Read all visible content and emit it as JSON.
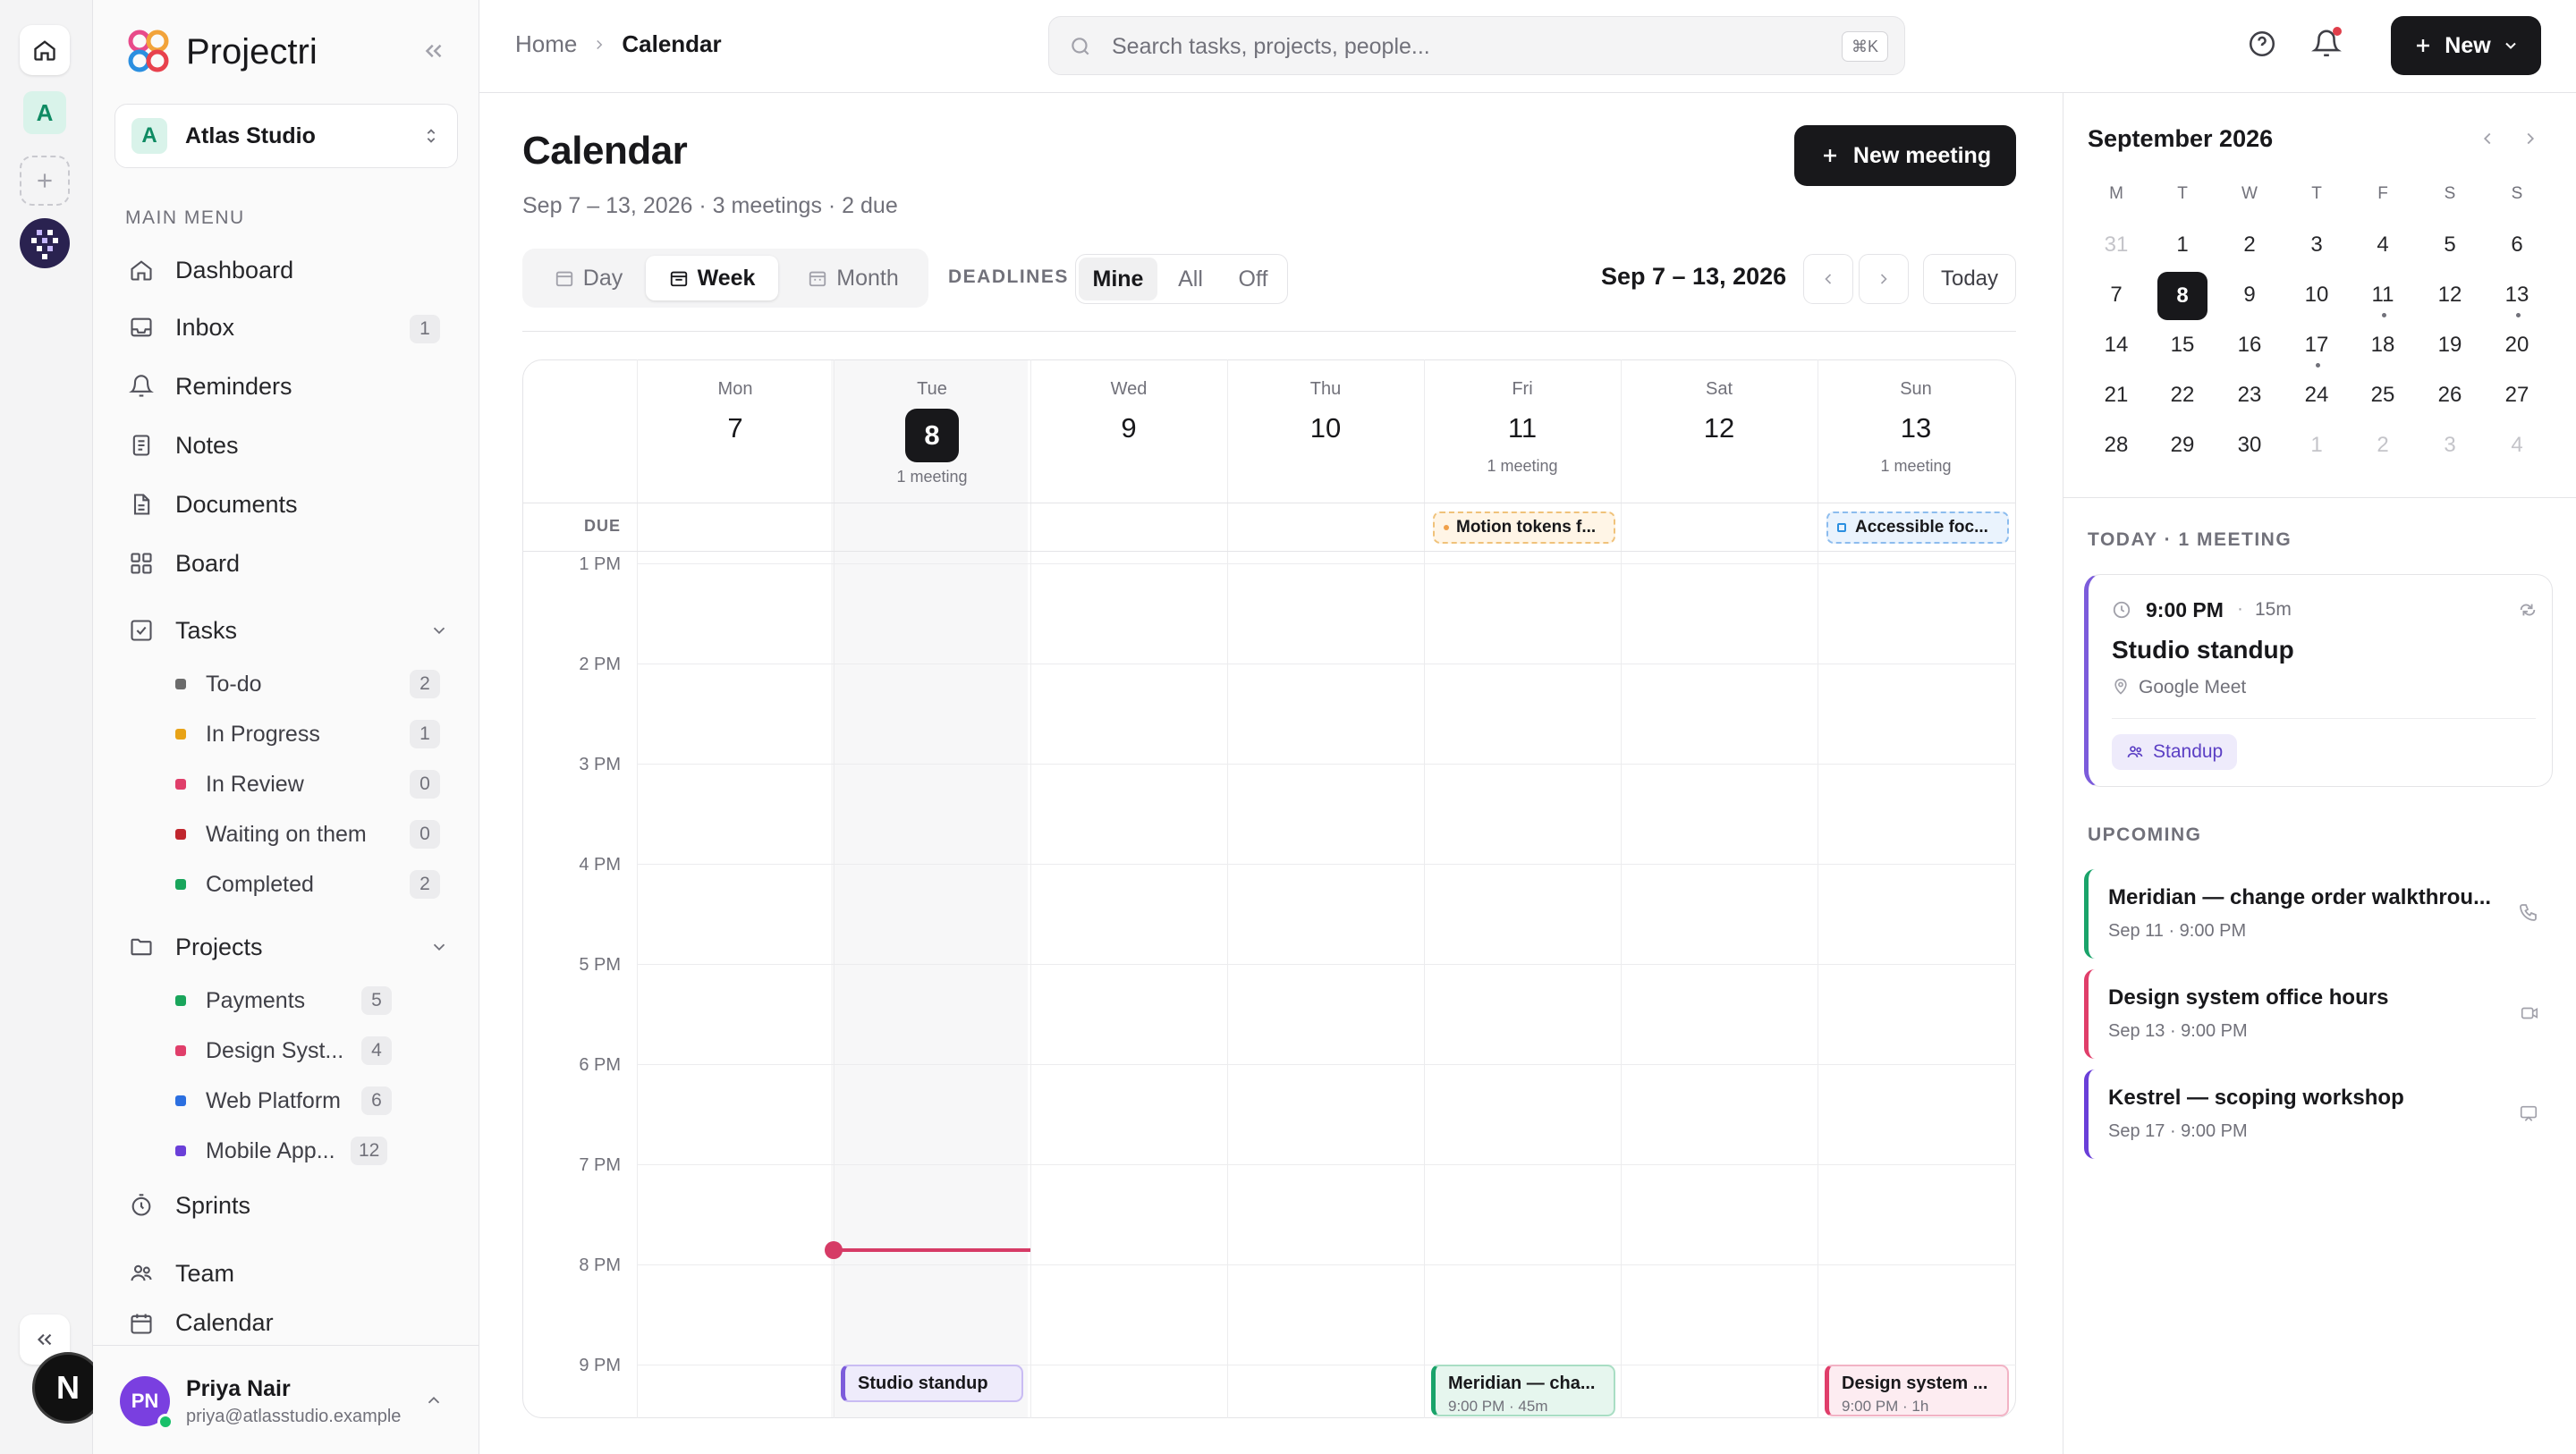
{
  "app": {
    "name": "Projectri"
  },
  "rail": {
    "workspace_letter": "A",
    "user_initial": "N"
  },
  "workspace": {
    "letter": "A",
    "name": "Atlas Studio"
  },
  "sidebar": {
    "section_label": "MAIN MENU",
    "items": [
      {
        "label": "Dashboard",
        "icon": "home-icon"
      },
      {
        "label": "Inbox",
        "icon": "inbox-icon",
        "count": "1"
      },
      {
        "label": "Reminders",
        "icon": "bell-icon"
      },
      {
        "label": "Notes",
        "icon": "note-icon"
      },
      {
        "label": "Documents",
        "icon": "document-icon"
      },
      {
        "label": "Board",
        "icon": "board-icon"
      }
    ],
    "tasks": {
      "label": "Tasks",
      "children": [
        {
          "label": "To-do",
          "count": "2",
          "color": "#6b6b6b"
        },
        {
          "label": "In Progress",
          "count": "1",
          "color": "#e8a317"
        },
        {
          "label": "In Review",
          "count": "0",
          "color": "#e03e6a"
        },
        {
          "label": "Waiting on them",
          "count": "0",
          "color": "#c0262d"
        },
        {
          "label": "Completed",
          "count": "2",
          "color": "#19a55b"
        }
      ]
    },
    "projects": {
      "label": "Projects",
      "children": [
        {
          "label": "Payments",
          "count": "5",
          "color": "#19a55b"
        },
        {
          "label": "Design Syst...",
          "count": "4",
          "color": "#e03e6a"
        },
        {
          "label": "Web Platform",
          "count": "6",
          "color": "#2b6fe0"
        },
        {
          "label": "Mobile App...",
          "count": "12",
          "color": "#6a3fd8"
        }
      ]
    },
    "bottom_items": [
      {
        "label": "Sprints",
        "icon": "stopwatch-icon"
      },
      {
        "label": "Team",
        "icon": "team-icon"
      },
      {
        "label": "Calendar",
        "icon": "calendar-icon"
      }
    ],
    "user": {
      "initials": "PN",
      "name": "Priya Nair",
      "email": "priya@atlasstudio.example"
    }
  },
  "breadcrumb": {
    "home": "Home",
    "current": "Calendar"
  },
  "search": {
    "placeholder": "Search tasks, projects, people...",
    "shortcut": "⌘K"
  },
  "header": {
    "new_label": "New"
  },
  "page": {
    "title": "Calendar",
    "subtitle": "Sep 7 – 13, 2026 · 3 meetings · 2 due",
    "new_meeting_label": "New meeting"
  },
  "view_tabs": {
    "day": "Day",
    "week": "Week",
    "month": "Month",
    "active": "Week"
  },
  "deadlines": {
    "label": "DEADLINES",
    "options": [
      "Mine",
      "All",
      "Off"
    ],
    "active": "Mine"
  },
  "range": {
    "label": "Sep 7 – 13, 2026",
    "today_label": "Today"
  },
  "week": {
    "days": [
      {
        "dow": "Mon",
        "num": "7",
        "meta": ""
      },
      {
        "dow": "Tue",
        "num": "8",
        "meta": "1 meeting",
        "today": true
      },
      {
        "dow": "Wed",
        "num": "9",
        "meta": ""
      },
      {
        "dow": "Thu",
        "num": "10",
        "meta": ""
      },
      {
        "dow": "Fri",
        "num": "11",
        "meta": "1 meeting"
      },
      {
        "dow": "Sat",
        "num": "12",
        "meta": ""
      },
      {
        "dow": "Sun",
        "num": "13",
        "meta": "1 meeting"
      }
    ],
    "due_label": "DUE",
    "due_items": [
      {
        "day": "Fri",
        "title": "Motion tokens f..."
      },
      {
        "day": "Sun",
        "title": "Accessible foc..."
      }
    ],
    "hours": [
      "1 PM",
      "2 PM",
      "3 PM",
      "4 PM",
      "5 PM",
      "6 PM",
      "7 PM",
      "8 PM",
      "9 PM"
    ],
    "now_time_hours": 20.0,
    "events": [
      {
        "day": "Tue",
        "title": "Studio standup",
        "meta": "",
        "color": "#7c5cdb"
      },
      {
        "day": "Fri",
        "title": "Meridian — cha...",
        "meta": "9:00 PM · 45m",
        "color": "#1aa36a"
      },
      {
        "day": "Sun",
        "title": "Design system ...",
        "meta": "9:00 PM · 1h",
        "color": "#e03e6a"
      }
    ]
  },
  "mini_calendar": {
    "title": "September 2026",
    "dows": [
      "M",
      "T",
      "W",
      "T",
      "F",
      "S",
      "S"
    ],
    "weeks": [
      [
        "31",
        "1",
        "2",
        "3",
        "4",
        "5",
        "6"
      ],
      [
        "7",
        "8",
        "9",
        "10",
        "11",
        "12",
        "13"
      ],
      [
        "14",
        "15",
        "16",
        "17",
        "18",
        "19",
        "20"
      ],
      [
        "21",
        "22",
        "23",
        "24",
        "25",
        "26",
        "27"
      ],
      [
        "28",
        "29",
        "30",
        "1",
        "2",
        "3",
        "4"
      ]
    ],
    "selected": "8",
    "event_dots": [
      "11",
      "13",
      "17"
    ]
  },
  "today_section": {
    "label": "TODAY · 1 MEETING",
    "card": {
      "time": "9:00 PM",
      "duration": "15m",
      "title": "Studio standup",
      "location": "Google Meet",
      "tag": "Standup"
    }
  },
  "upcoming": {
    "label": "UPCOMING",
    "items": [
      {
        "title": "Meridian — change order walkthrou...",
        "meta": "Sep 11 · 9:00 PM",
        "color": "#1aa36a",
        "icon": "phone-icon"
      },
      {
        "title": "Design system office hours",
        "meta": "Sep 13 · 9:00 PM",
        "color": "#e03e6a",
        "icon": "video-icon"
      },
      {
        "title": "Kestrel — scoping workshop",
        "meta": "Sep 17 · 9:00 PM",
        "color": "#6a3fd8",
        "icon": "presentation-icon"
      }
    ]
  },
  "colors": {
    "accent": "#18181b",
    "now_line": "#d63b66",
    "today_bg": "#f4f4f5"
  }
}
